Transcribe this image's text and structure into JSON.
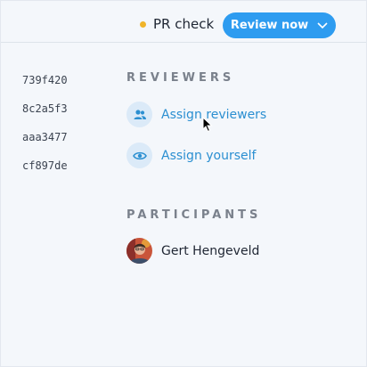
{
  "header": {
    "status_label": "PR check",
    "status_color": "#f0b429",
    "review_button_label": "Review now",
    "review_button_color": "#2e9cf0"
  },
  "commits": [
    "739f420",
    "8c2a5f3",
    "aaa3477",
    "cf897de"
  ],
  "reviewers": {
    "title": "REVIEWERS",
    "actions": [
      {
        "label": "Assign reviewers",
        "icon": "users-icon"
      },
      {
        "label": "Assign yourself",
        "icon": "eye-icon"
      }
    ]
  },
  "participants": {
    "title": "PARTICIPANTS",
    "people": [
      {
        "name": "Gert Hengeveld",
        "avatar": "avatar"
      }
    ]
  }
}
